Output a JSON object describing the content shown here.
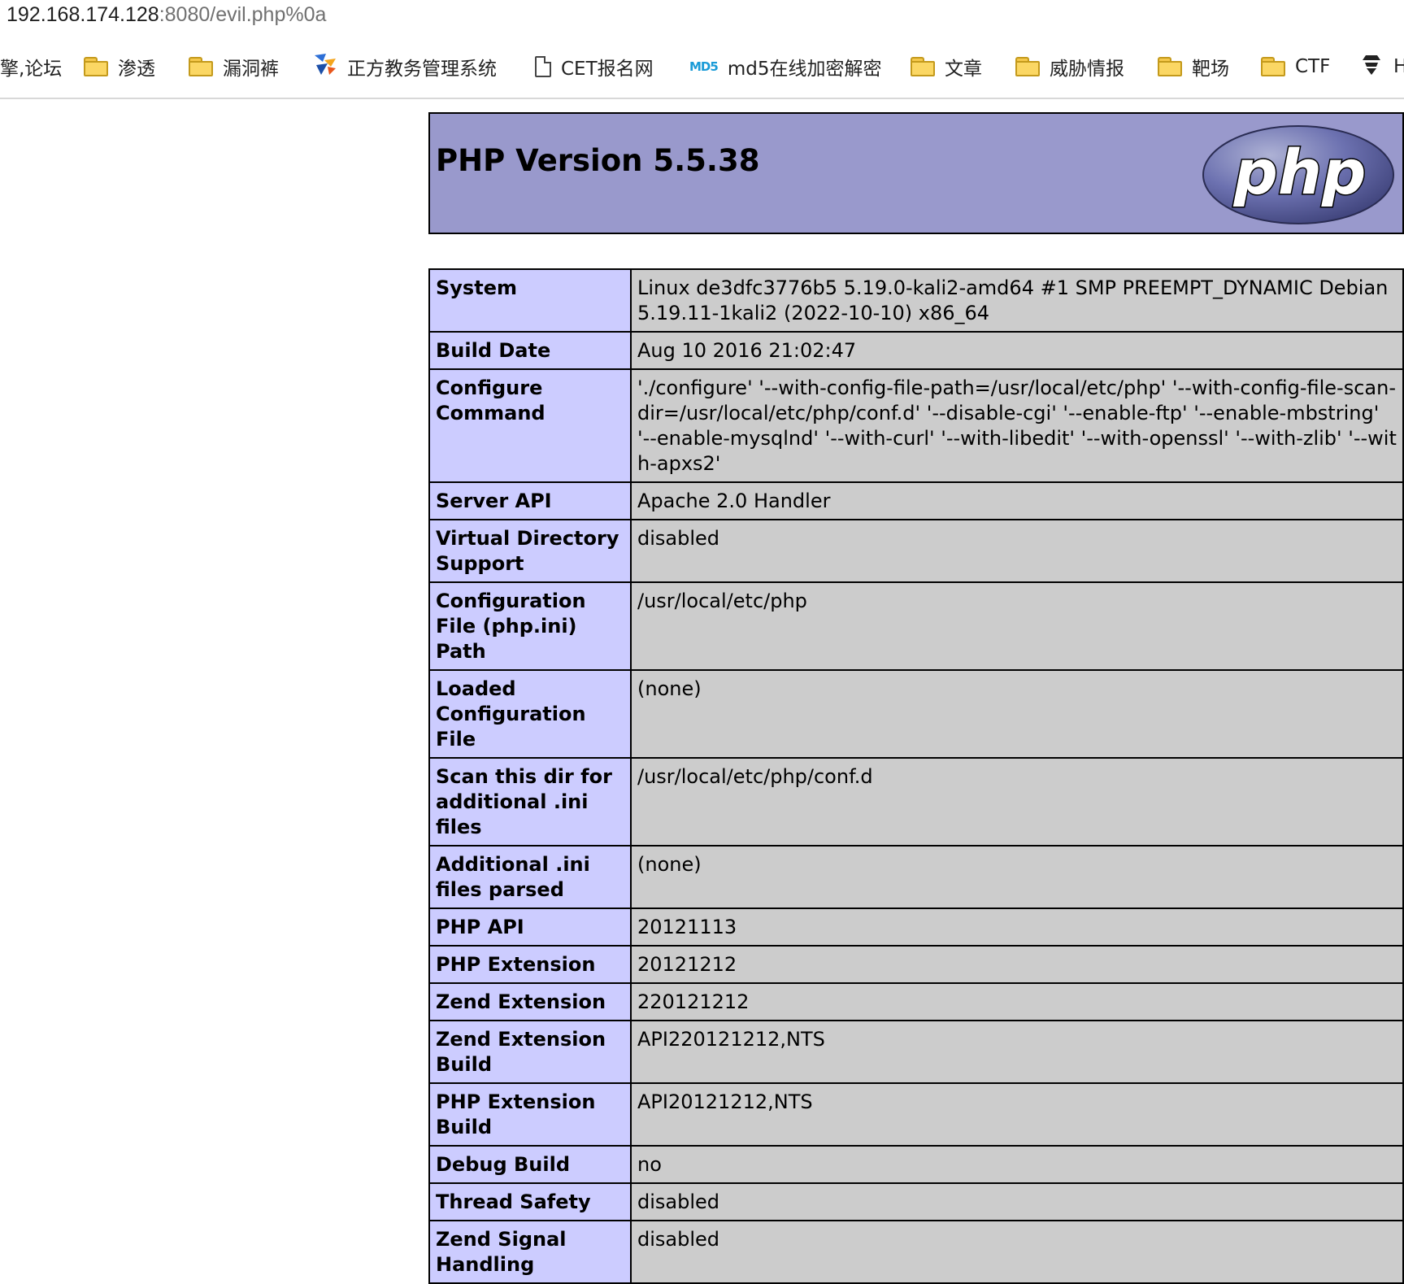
{
  "browser": {
    "url_host": "192.168.174.128",
    "url_rest": ":8080/evil.php%0a"
  },
  "bookmarks": [
    {
      "label": "擎,论坛",
      "icon": "none"
    },
    {
      "label": "渗透",
      "icon": "folder-icon"
    },
    {
      "label": "漏洞裤",
      "icon": "folder-icon"
    },
    {
      "label": "正方教务管理系统",
      "icon": "zf-logo-icon"
    },
    {
      "label": "CET报名网",
      "icon": "document-icon"
    },
    {
      "label": "md5在线加密解密",
      "icon": "md5-icon"
    },
    {
      "label": "文章",
      "icon": "folder-icon"
    },
    {
      "label": "威胁情报",
      "icon": "folder-icon"
    },
    {
      "label": "靶场",
      "icon": "folder-icon"
    },
    {
      "label": "CTF",
      "icon": "folder-icon"
    },
    {
      "label": "H",
      "icon": "hacker-icon"
    }
  ],
  "phpinfo": {
    "title": "PHP Version 5.5.38",
    "logo_text": "php",
    "rows": [
      {
        "key": "System",
        "value": "Linux de3dfc3776b5 5.19.0-kali2-amd64 #1 SMP PREEMPT_DYNAMIC Debian 5.19.11-1kali2 (2022-10-10) x86_64"
      },
      {
        "key": "Build Date",
        "value": "Aug 10 2016 21:02:47"
      },
      {
        "key": "Configure Command",
        "value": "'./configure' '--with-config-file-path=/usr/local/etc/php' '--with-config-file-scan-dir=/usr/local/etc/php/conf.d' '--disable-cgi' '--enable-ftp' '--enable-mbstring' '--enable-mysqlnd' '--with-curl' '--with-libedit' '--with-openssl' '--with-zlib' '--with-apxs2'"
      },
      {
        "key": "Server API",
        "value": "Apache 2.0 Handler"
      },
      {
        "key": "Virtual Directory Support",
        "value": "disabled"
      },
      {
        "key": "Configuration File (php.ini) Path",
        "value": "/usr/local/etc/php"
      },
      {
        "key": "Loaded Configuration File",
        "value": "(none)"
      },
      {
        "key": "Scan this dir for additional .ini files",
        "value": "/usr/local/etc/php/conf.d"
      },
      {
        "key": "Additional .ini files parsed",
        "value": "(none)"
      },
      {
        "key": "PHP API",
        "value": "20121113"
      },
      {
        "key": "PHP Extension",
        "value": "20121212"
      },
      {
        "key": "Zend Extension",
        "value": "220121212"
      },
      {
        "key": "Zend Extension Build",
        "value": "API220121212,NTS"
      },
      {
        "key": "PHP Extension Build",
        "value": "API20121212,NTS"
      },
      {
        "key": "Debug Build",
        "value": "no"
      },
      {
        "key": "Thread Safety",
        "value": "disabled"
      },
      {
        "key": "Zend Signal Handling",
        "value": "disabled"
      }
    ]
  }
}
